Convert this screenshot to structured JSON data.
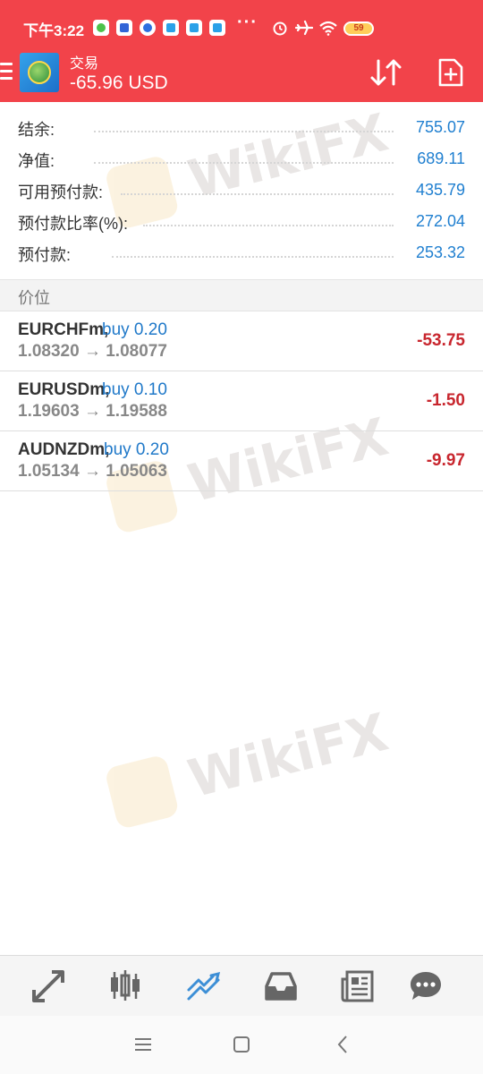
{
  "status_bar": {
    "time": "下午3:22",
    "more": "···",
    "battery": "59"
  },
  "header": {
    "title": "交易",
    "balance_change": "-65.96 USD"
  },
  "summary": [
    {
      "label": "结余:",
      "value": "755.07"
    },
    {
      "label": "净值:",
      "value": "689.11"
    },
    {
      "label": "可用预付款:",
      "value": "435.79"
    },
    {
      "label": "预付款比率(%):",
      "value": "272.04"
    },
    {
      "label": "预付款:",
      "value": "253.32"
    }
  ],
  "section": {
    "title": "价位"
  },
  "positions": [
    {
      "symbol": "EURCHFm,",
      "direction": "buy 0.20",
      "prices": "1.08320 → 1.08077",
      "profit": "-53.75"
    },
    {
      "symbol": "EURUSDm,",
      "direction": "buy 0.10",
      "prices": "1.19603 → 1.19588",
      "profit": "-1.50"
    },
    {
      "symbol": "AUDNZDm,",
      "direction": "buy 0.20",
      "prices": "1.05134 → 1.05063",
      "profit": "-9.97"
    }
  ],
  "watermark": "WikiFX",
  "toolbar": {
    "items": [
      "quotes-icon",
      "chart-icon",
      "trade-icon",
      "history-icon",
      "news-icon",
      "chat-icon"
    ],
    "active": "trade-icon"
  },
  "colors": {
    "header_bg": "#f2434a",
    "value_blue": "#1f7fd0",
    "loss_red": "#c8262e"
  }
}
